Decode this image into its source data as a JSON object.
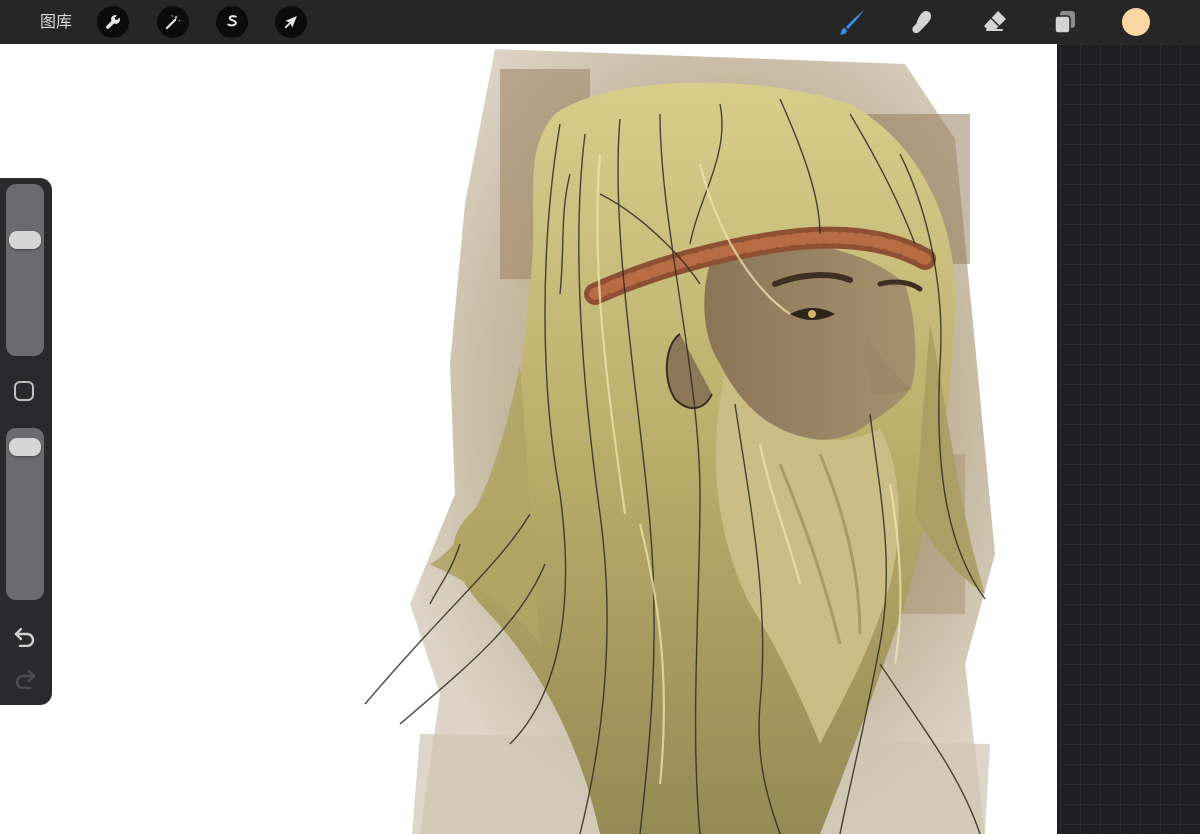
{
  "toolbar": {
    "gallery_label": "图库",
    "left_tools": [
      {
        "name": "actions",
        "icon": "wrench-icon"
      },
      {
        "name": "adjustments",
        "icon": "magic-wand-icon"
      },
      {
        "name": "selection",
        "icon": "selection-s-icon"
      },
      {
        "name": "transform",
        "icon": "arrow-cursor-icon"
      }
    ],
    "right_tools": [
      {
        "name": "brush",
        "icon": "brush-icon",
        "active": true
      },
      {
        "name": "smudge",
        "icon": "smudge-finger-icon",
        "active": false
      },
      {
        "name": "eraser",
        "icon": "eraser-icon",
        "active": false
      },
      {
        "name": "layers",
        "icon": "layers-icon",
        "active": false
      }
    ],
    "current_color": "#f9d6a3"
  },
  "colors": {
    "toolbar_bg": "#262627",
    "active_tool": "#3a8ee6",
    "inactive_tool": "#d4d4d4",
    "canvas_bg": "#ffffff",
    "workspace_bg": "#1e1e20"
  },
  "sidebar": {
    "brush_size_level": 0.7,
    "opacity_level": 0.95,
    "modify_icon": "square-outline-icon",
    "undo_icon": "undo-arrow-icon",
    "redo_icon": "redo-arrow-icon",
    "redo_enabled": false
  }
}
